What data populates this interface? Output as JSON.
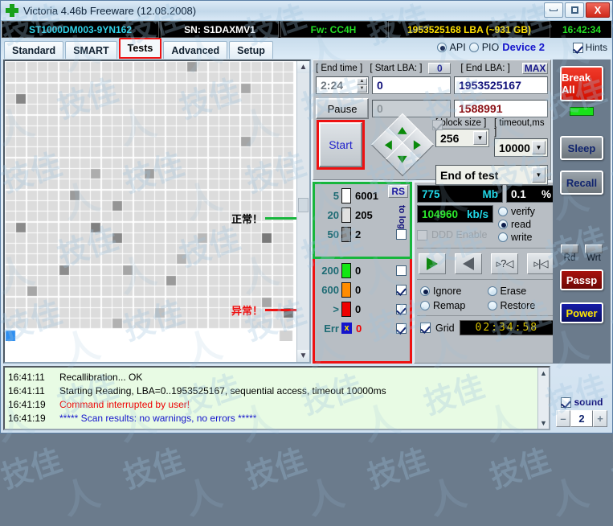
{
  "window": {
    "title": "Victoria 4.46b Freeware (12.08.2008)",
    "icon": "cross-icon",
    "minimize": "minimize-icon",
    "maximize": "maximize-icon",
    "close": "X"
  },
  "driveinfo": {
    "model": "ST1000DM003-9YN162",
    "serial": "SN: S1DAXMV1",
    "firmware": "Fw: CC4H",
    "capacity": "1953525168 LBA (~931 GB)",
    "clock": "16:42:34",
    "colors": {
      "model": "#31d2e8",
      "serial": "#ffffff",
      "firmware": "#24e024",
      "capacity": "#ffe000",
      "clock": "#24e024"
    }
  },
  "tabs": [
    {
      "label": "Standard",
      "active": false
    },
    {
      "label": "SMART",
      "active": false
    },
    {
      "label": "Tests",
      "active": true
    },
    {
      "label": "Advanced",
      "active": false
    },
    {
      "label": "Setup",
      "active": false
    }
  ],
  "iface": {
    "api_label": "API",
    "api_selected": true,
    "pio_label": "PIO",
    "pio_selected": false,
    "device_label": "Device 2",
    "hints_label": "Hints",
    "hints_checked": true
  },
  "annotations": [
    {
      "text": "正常！",
      "color": "#000000",
      "line_color": "#17b63c"
    },
    {
      "text": "异常！",
      "color": "#ee1111",
      "line_color": "#ee1111"
    }
  ],
  "controls": {
    "end_time_label": "[ End time ]",
    "end_time_value": "2:24",
    "start_lba_label": "[ Start LBA: ]",
    "start_lba_button": "0",
    "start_lba_value": "0",
    "end_lba_label": "[ End LBA: ]",
    "end_lba_button": "MAX",
    "end_lba_value": "1953525167",
    "pause_label": "Pause",
    "second_row_left": "0",
    "current_lba_value": "1588991",
    "start_label": "Start",
    "block_size_label": "[ block size ]",
    "block_size_value": "256",
    "timeout_label": "[ timeout,ms ]",
    "timeout_value": "10000",
    "end_of_test_value": "End of test",
    "dpad_check_checked": true
  },
  "stats_green": {
    "rs_label": "RS",
    "to_log_label": "to log:",
    "rows": [
      {
        "threshold": "5",
        "swatch": "#ffffff",
        "count": "6001",
        "checkbox": null
      },
      {
        "threshold": "20",
        "swatch": "#e0e0e0",
        "count": "205",
        "checkbox": null
      },
      {
        "threshold": "50",
        "swatch": "#8a8a8a",
        "count": "2",
        "checkbox": false
      }
    ]
  },
  "stats_red": {
    "rows": [
      {
        "threshold": "200",
        "swatch": "#12e712",
        "count": "0",
        "checked": false,
        "count_color": "#000000"
      },
      {
        "threshold": "600",
        "swatch": "#ff8c00",
        "count": "0",
        "checked": true,
        "count_color": "#000000"
      },
      {
        "threshold": ">",
        "swatch": "#ee0000",
        "count": "0",
        "checked": true,
        "count_color": "#000000"
      },
      {
        "threshold": "Err",
        "swatch": "#1414cc",
        "count": "0",
        "checked": true,
        "count_color": "#ee0000"
      }
    ]
  },
  "readout": {
    "size_value": "775",
    "size_unit": "Mb",
    "percent_value": "0.1",
    "percent_unit": "%",
    "speed_value": "104960",
    "speed_unit": "kb/s",
    "ddd_label": "DDD Enable",
    "ddd_checked": false,
    "modes": [
      {
        "label": "verify",
        "selected": false
      },
      {
        "label": "read",
        "selected": true
      },
      {
        "label": "write",
        "selected": false
      }
    ],
    "transport_buttons": [
      "play-forward-icon",
      "play-backward-icon",
      "random-seek-icon",
      "butterfly-seek-icon"
    ],
    "actions": [
      {
        "label": "Ignore",
        "selected": true
      },
      {
        "label": "Erase",
        "selected": false
      },
      {
        "label": "Remap",
        "selected": false
      },
      {
        "label": "Restore",
        "selected": false
      }
    ],
    "grid_label": "Grid",
    "grid_checked": true,
    "timer": "02:34:58"
  },
  "rightbar": {
    "break_all": "Break All",
    "sleep": "Sleep",
    "recall": "Recall",
    "rd_label": "Rd",
    "wrt_label": "Wrt",
    "passp": "Passp",
    "power": "Power"
  },
  "log": {
    "lines": [
      {
        "time": "16:41:11",
        "text": "Recallibration... OK",
        "color": "#000000"
      },
      {
        "time": "16:41:11",
        "text": "Starting Reading, LBA=0..1953525167, sequential access, timeout 10000ms",
        "color": "#000000"
      },
      {
        "time": "16:41:19",
        "text": "Command interrupted by user!",
        "color": "#ee0000"
      },
      {
        "time": "16:41:19",
        "text": "***** Scan results: no warnings, no errors *****",
        "color": "#1414cc"
      }
    ]
  },
  "sound": {
    "label": "sound",
    "checked": true,
    "minus": "–",
    "value": "2",
    "plus": "+"
  },
  "watermark": {
    "text": "技佳"
  }
}
